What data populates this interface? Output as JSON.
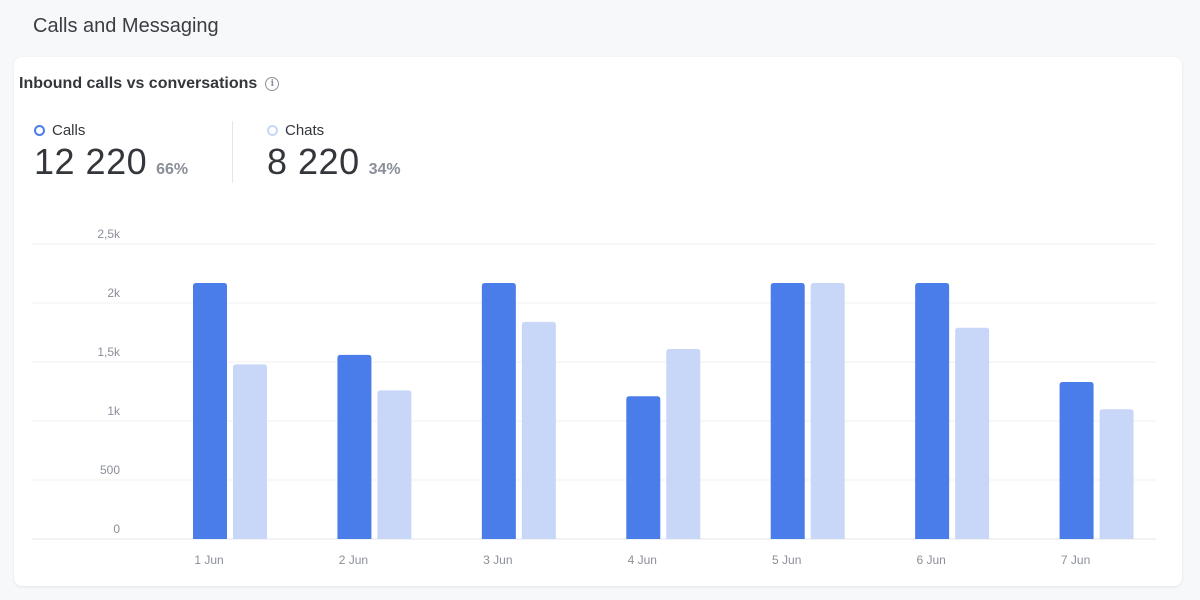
{
  "page": {
    "title": "Calls and Messaging"
  },
  "card": {
    "title": "Inbound calls vs conversations",
    "info_icon": "info-icon"
  },
  "stats": {
    "calls": {
      "label": "Calls",
      "value": "12 220",
      "percent": "66%",
      "color": "#4a7de9"
    },
    "chats": {
      "label": "Chats",
      "value": "8 220",
      "percent": "34%",
      "color": "#c8d7f7"
    }
  },
  "chart_data": {
    "type": "bar",
    "categories": [
      "1 Jun",
      "2 Jun",
      "3 Jun",
      "4 Jun",
      "5 Jun",
      "6 Jun",
      "7 Jun"
    ],
    "series": [
      {
        "name": "Calls",
        "color": "#4a7de9",
        "values": [
          2170,
          1560,
          2170,
          1210,
          2170,
          2170,
          1330
        ]
      },
      {
        "name": "Chats",
        "color": "#c8d7f7",
        "values": [
          1480,
          1260,
          1840,
          1610,
          2170,
          1790,
          1100
        ]
      }
    ],
    "y_ticks": [
      "0",
      "500",
      "1k",
      "1,5k",
      "2k",
      "2,5k"
    ],
    "ylim": [
      0,
      2500
    ],
    "grid": true
  }
}
